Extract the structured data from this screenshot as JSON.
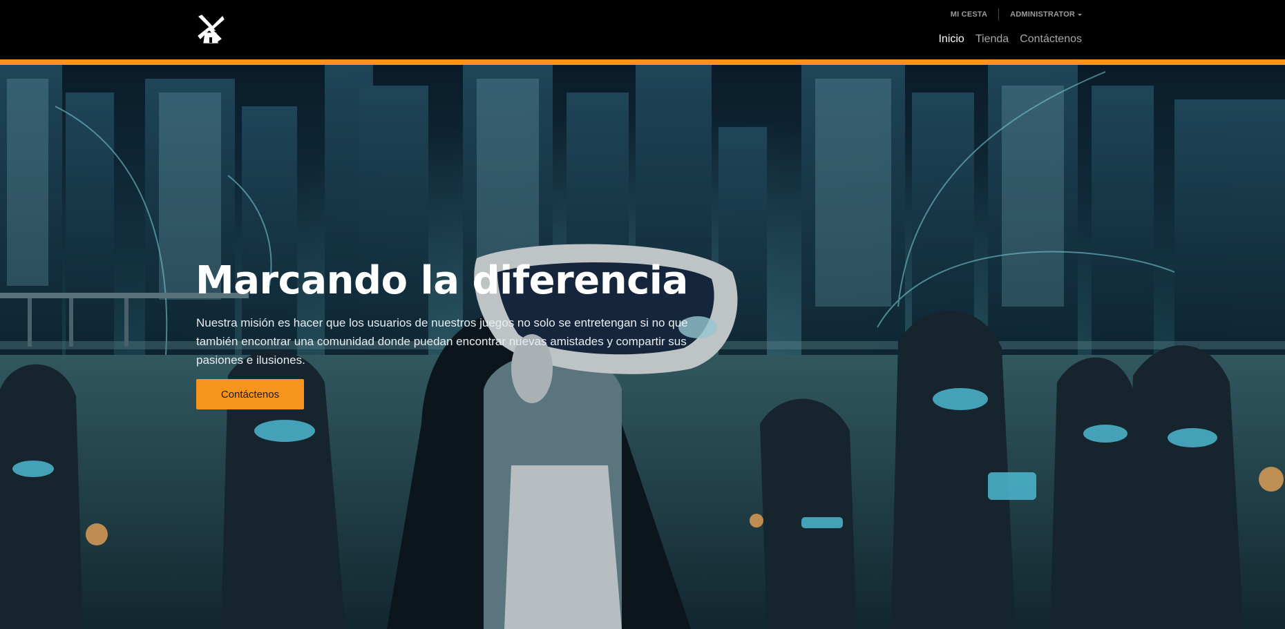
{
  "header": {
    "logo_icon": "windmill-icon",
    "top_links": [
      {
        "label": "MI CESTA"
      },
      {
        "label": "ADMINISTRATOR",
        "dropdown": true
      }
    ],
    "nav": [
      {
        "label": "Inicio",
        "active": true
      },
      {
        "label": "Tienda",
        "active": false
      },
      {
        "label": "Contáctenos",
        "active": false
      }
    ]
  },
  "hero": {
    "title": "Marcando la diferencia",
    "text": "Nuestra misión es hacer que los usuarios de nuestros juegos no solo se entretengan si no que también encontrar una comunidad donde puedan encontrar nuevas amistades y compartir sus pasiones e ilusiones.",
    "button_label": "Contáctenos"
  },
  "colors": {
    "accent": "#f7941d",
    "header_bg": "#000000",
    "nav_active": "#ffffff",
    "nav_inactive": "#a8a8a8"
  }
}
